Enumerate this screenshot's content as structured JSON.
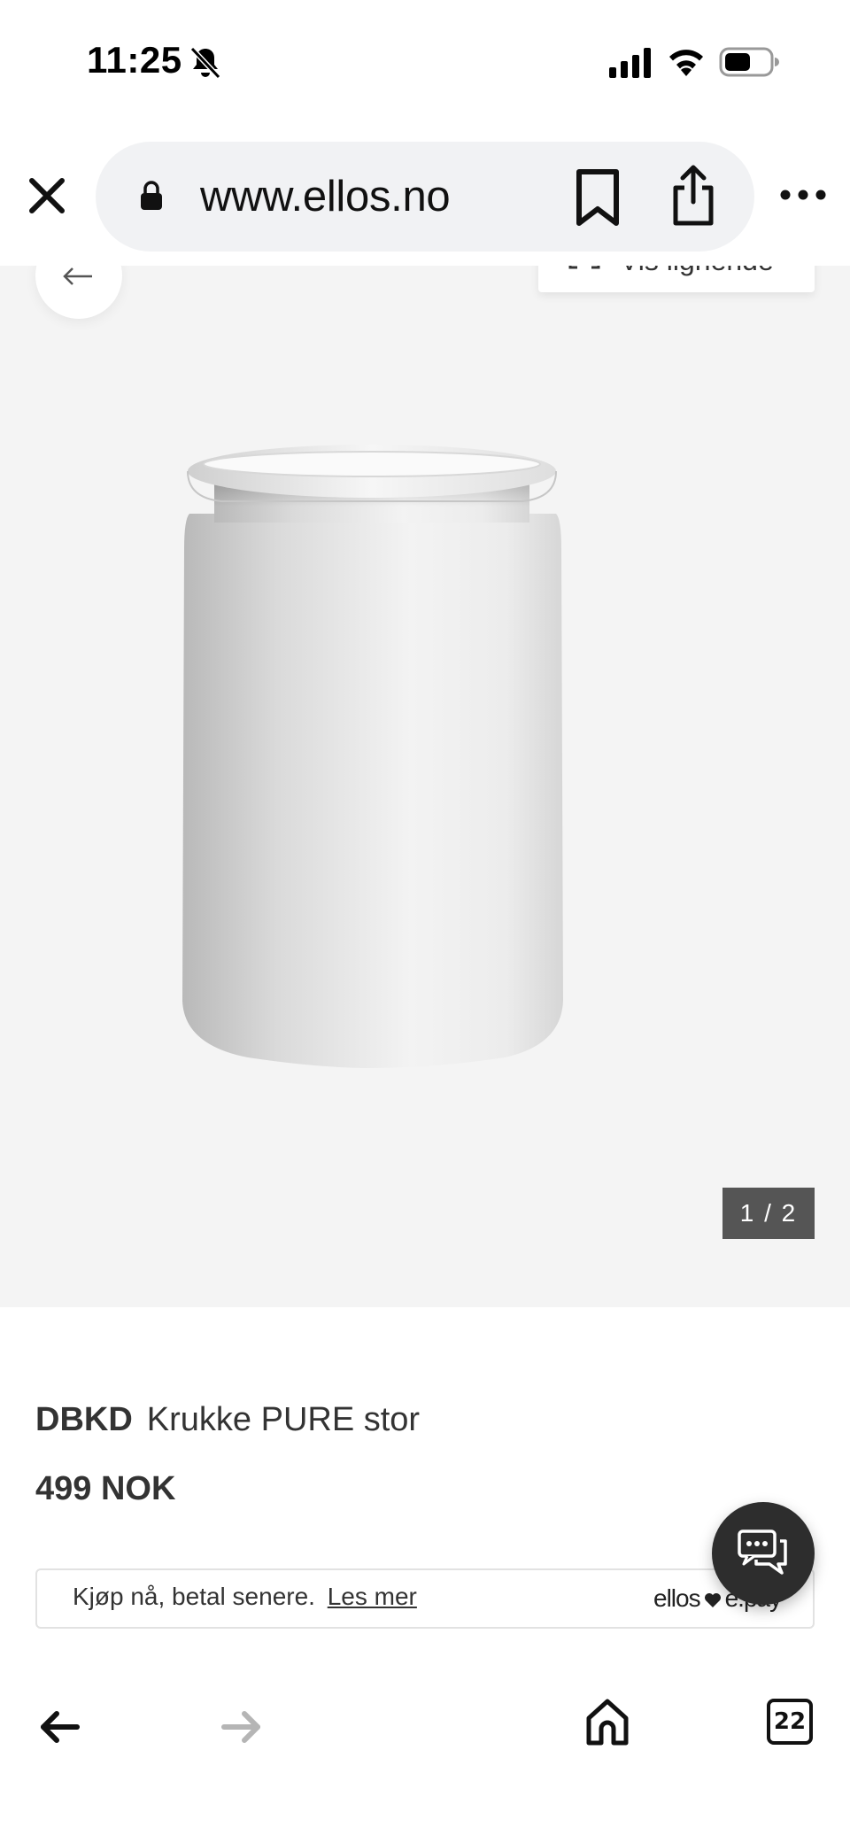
{
  "status_bar": {
    "time": "11:25",
    "icons": [
      "bell-slash-icon",
      "cellular-signal-icon",
      "wifi-icon",
      "battery-icon"
    ]
  },
  "browser": {
    "url": "www.ellos.no",
    "icons": [
      "close-icon",
      "lock-icon",
      "bookmark-icon",
      "share-icon",
      "more-icon"
    ]
  },
  "gallery": {
    "similar_label": "Vis lignende",
    "counter": "1 / 2"
  },
  "product": {
    "brand": "DBKD",
    "name": "Krukke PURE stor",
    "price": "499 NOK"
  },
  "payment": {
    "text": "Kjøp nå, betal senere.",
    "link": "Les mer",
    "logo_left": "ellos",
    "logo_right": "e.pay"
  },
  "toolbar": {
    "tab_count": "22"
  },
  "colors": {
    "image_bg": "#f4f4f4",
    "counter_bg": "#555555",
    "chat_bg": "#2d2d2d",
    "text": "#333333"
  }
}
